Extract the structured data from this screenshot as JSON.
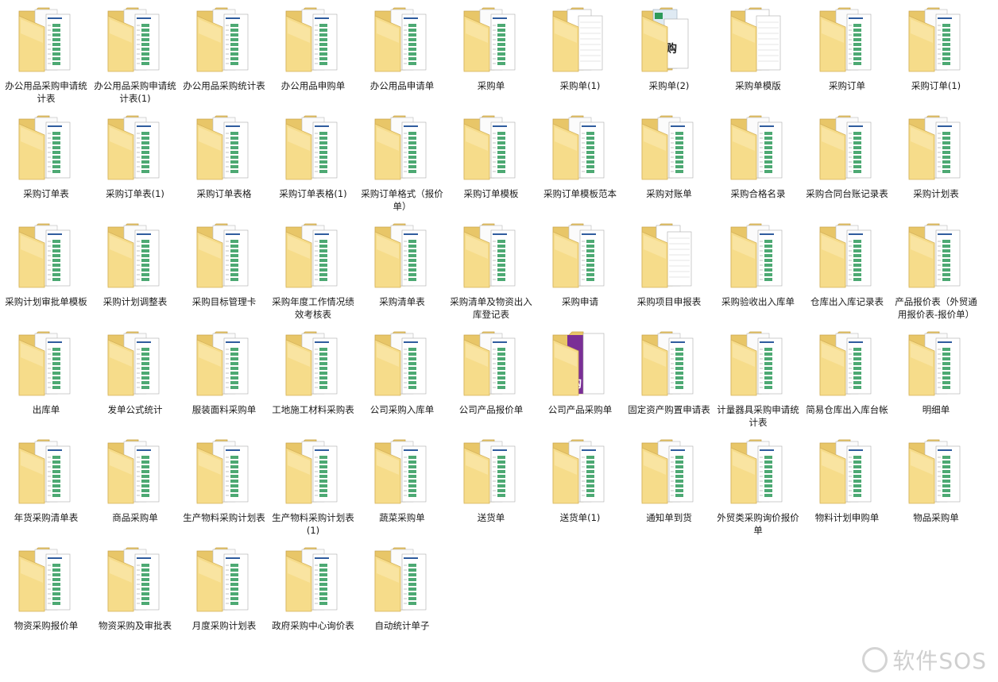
{
  "folders": [
    {
      "label": "办公用品采购申请统计表",
      "variant": "sheet"
    },
    {
      "label": "办公用品采购申请统计表(1)",
      "variant": "sheet"
    },
    {
      "label": "办公用品采购统计表",
      "variant": "sheet"
    },
    {
      "label": "办公用品申购单",
      "variant": "sheet"
    },
    {
      "label": "办公用品申请单",
      "variant": "sheet"
    },
    {
      "label": "采购单",
      "variant": "sheet"
    },
    {
      "label": "采购单(1)",
      "variant": "form"
    },
    {
      "label": "采购单(2)",
      "variant": "cover"
    },
    {
      "label": "采购单模版",
      "variant": "form"
    },
    {
      "label": "采购订单",
      "variant": "sheet"
    },
    {
      "label": "采购订单(1)",
      "variant": "sheet"
    },
    {
      "label": "采购订单表",
      "variant": "sheet"
    },
    {
      "label": "采购订单表(1)",
      "variant": "sheet"
    },
    {
      "label": "采购订单表格",
      "variant": "sheet"
    },
    {
      "label": "采购订单表格(1)",
      "variant": "sheet"
    },
    {
      "label": "采购订单格式（报价单）",
      "variant": "sheet"
    },
    {
      "label": "采购订单模板",
      "variant": "sheet"
    },
    {
      "label": "采购订单模板范本",
      "variant": "sheet"
    },
    {
      "label": "采购对账单",
      "variant": "sheet"
    },
    {
      "label": "采购合格名录",
      "variant": "sheet"
    },
    {
      "label": "采购合同台账记录表",
      "variant": "sheet"
    },
    {
      "label": "采购计划表",
      "variant": "sheet"
    },
    {
      "label": "采购计划审批单模板",
      "variant": "sheet"
    },
    {
      "label": "采购计划调整表",
      "variant": "sheet"
    },
    {
      "label": "采购目标管理卡",
      "variant": "sheet"
    },
    {
      "label": "采购年度工作情况绩效考核表",
      "variant": "sheet"
    },
    {
      "label": "采购清单表",
      "variant": "sheet"
    },
    {
      "label": "采购清单及物资出入库登记表",
      "variant": "sheet"
    },
    {
      "label": "采购申请",
      "variant": "sheet"
    },
    {
      "label": "采购项目申报表",
      "variant": "form"
    },
    {
      "label": "采购验收出入库单",
      "variant": "sheet"
    },
    {
      "label": "仓库出入库记录表",
      "variant": "sheet"
    },
    {
      "label": "产品报价表（外贸通用报价表-报价单）",
      "variant": "sheet"
    },
    {
      "label": "出库单",
      "variant": "sheet"
    },
    {
      "label": "发单公式统计",
      "variant": "sheet"
    },
    {
      "label": "服装面料采购单",
      "variant": "sheet"
    },
    {
      "label": "工地施工材料采购表",
      "variant": "sheet"
    },
    {
      "label": "公司采购入库单",
      "variant": "sheet"
    },
    {
      "label": "公司产品报价单",
      "variant": "sheet"
    },
    {
      "label": "公司产品采购单",
      "variant": "purple"
    },
    {
      "label": "固定资产购置申请表",
      "variant": "sheet"
    },
    {
      "label": "计量器具采购申请统计表",
      "variant": "sheet"
    },
    {
      "label": "简易仓库出入库台帐",
      "variant": "sheet"
    },
    {
      "label": "明细单",
      "variant": "sheet"
    },
    {
      "label": "年货采购清单表",
      "variant": "sheet"
    },
    {
      "label": "商品采购单",
      "variant": "sheet"
    },
    {
      "label": "生产物料采购计划表",
      "variant": "sheet"
    },
    {
      "label": "生产物料采购计划表(1)",
      "variant": "sheet"
    },
    {
      "label": "蔬菜采购单",
      "variant": "sheet"
    },
    {
      "label": "送货单",
      "variant": "sheet"
    },
    {
      "label": "送货单(1)",
      "variant": "sheet"
    },
    {
      "label": "通知单到货",
      "variant": "sheet"
    },
    {
      "label": "外贸类采购询价报价单",
      "variant": "sheet"
    },
    {
      "label": "物料计划申购单",
      "variant": "sheet"
    },
    {
      "label": "物品采购单",
      "variant": "sheet"
    },
    {
      "label": "物资采购报价单",
      "variant": "sheet"
    },
    {
      "label": "物资采购及审批表",
      "variant": "sheet"
    },
    {
      "label": "月度采购计划表",
      "variant": "sheet"
    },
    {
      "label": "政府采购中心询价表",
      "variant": "sheet"
    },
    {
      "label": "自动统计单子",
      "variant": "sheet"
    }
  ],
  "colors": {
    "folder_back": "#e8c668",
    "folder_front": "#f6dc8a",
    "folder_front_light": "#fbeab0",
    "sheet_green": "#2e9a5a",
    "sheet_blue": "#2f5c9e",
    "purple": "#7a2f96"
  },
  "watermark": {
    "text": "软件SOS"
  }
}
